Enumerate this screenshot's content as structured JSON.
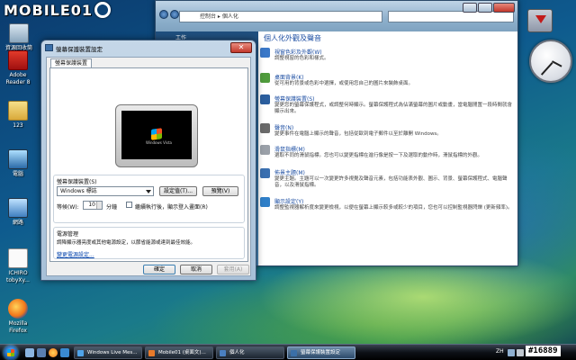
{
  "watermark": {
    "text": "MOBILE01"
  },
  "desktop_icons": [
    {
      "label": "資源回收筒",
      "icon": "recycle-bin-icon"
    },
    {
      "label": "Adobe Reader 8",
      "icon": "adobe-reader-icon"
    },
    {
      "label": "123",
      "icon": "folder-icon"
    },
    {
      "label": "電腦",
      "icon": "computer-icon"
    },
    {
      "label": "網路",
      "icon": "network-icon"
    },
    {
      "label": "ICHIRO tobyXy...",
      "icon": "document-icon"
    },
    {
      "label": "Mozilla Firefox",
      "icon": "firefox-icon"
    }
  ],
  "control_panel": {
    "address_path": "控制台 ▸ 個人化",
    "search_placeholder": "",
    "left_pane_label": "工作",
    "heading": "個人化外觀及聲音",
    "items": [
      {
        "title": "視窗色彩及外觀(W)",
        "desc": "調整視窗的色彩和樣式。",
        "icon_color": "#3a78c8"
      },
      {
        "title": "桌面背景(K)",
        "desc": "從可用的背景或色彩中選擇，或使用您自己的圖片來裝飾桌面。",
        "icon_color": "#4f9b3c"
      },
      {
        "title": "螢幕保護裝置(S)",
        "desc": "變更您的螢幕保護程式，或調整何時顯示。螢幕保護程式為佔滿螢幕的圖片或動畫，當電腦閒置一段時間就會顯示出來。",
        "icon_color": "#2b5e9e"
      },
      {
        "title": "聲音(N)",
        "desc": "變更事件在電腦上顯示的聲音，包括從歐到電子郵件以至於離開 Windows。",
        "icon_color": "#6a6a6a"
      },
      {
        "title": "滑鼠指標(M)",
        "desc": "選取不同的滑鼠指標。您也可以變更指標在進行像是按一下及選取的動作時，滑鼠指標的外觀。",
        "icon_color": "#9aa0a8"
      },
      {
        "title": "佈景主題(M)",
        "desc": "變更主題。主題可以一次變更許多視覺及聲音元素，包括功能表外觀、圖示、背景、螢幕保護程式、電腦聲音，以及滑鼠指標。",
        "icon_color": "#3a6fb0"
      },
      {
        "title": "顯示設定(Y)",
        "desc": "調整監視器解析度來變更檢視，以便在螢幕上顯示較多或較少的項目，您也可以控制監視器閃爍 (更新頻率)。",
        "icon_color": "#2f7fc8"
      }
    ]
  },
  "screensaver_dialog": {
    "title": "螢幕保護裝置設定",
    "close_glyph": "✕",
    "tab_label": "螢幕保護裝置",
    "preview_logo_text": "Windows Vista",
    "group_label": "螢幕保護裝置(S)",
    "screensaver_value": "Windows 標誌",
    "settings_button": "設定值(T)...",
    "preview_button": "預覽(V)",
    "wait_label": "等候(W):",
    "wait_value": "10",
    "wait_unit": "分鐘",
    "resume_checkbox_label": "繼續執行後，顯示登入畫面(R)",
    "resume_checked": false,
    "power_group_label": "電源管理",
    "power_desc": "調降顯示器亮度或其他電源設定，以節省能源或達到最佳效能。",
    "power_link": "變更電源設定...",
    "ok_button": "確定",
    "cancel_button": "取消",
    "apply_button": "套用(A)"
  },
  "clock": {
    "hour_angle": 118,
    "minute_angle": 222
  },
  "taskbar": {
    "buttons": [
      {
        "label": "Windows Live Mes...",
        "icon_color": "#4fa3e8",
        "active": false
      },
      {
        "label": "Mobile01 (桌面文)...",
        "icon_color": "#e87a2a",
        "active": false
      },
      {
        "label": "個人化",
        "icon_color": "#4a7fc0",
        "active": false
      },
      {
        "label": "螢幕保護裝置設定",
        "icon_color": "#3a6fa8",
        "active": true
      }
    ],
    "language": "ZH",
    "stamp": "#16889"
  }
}
